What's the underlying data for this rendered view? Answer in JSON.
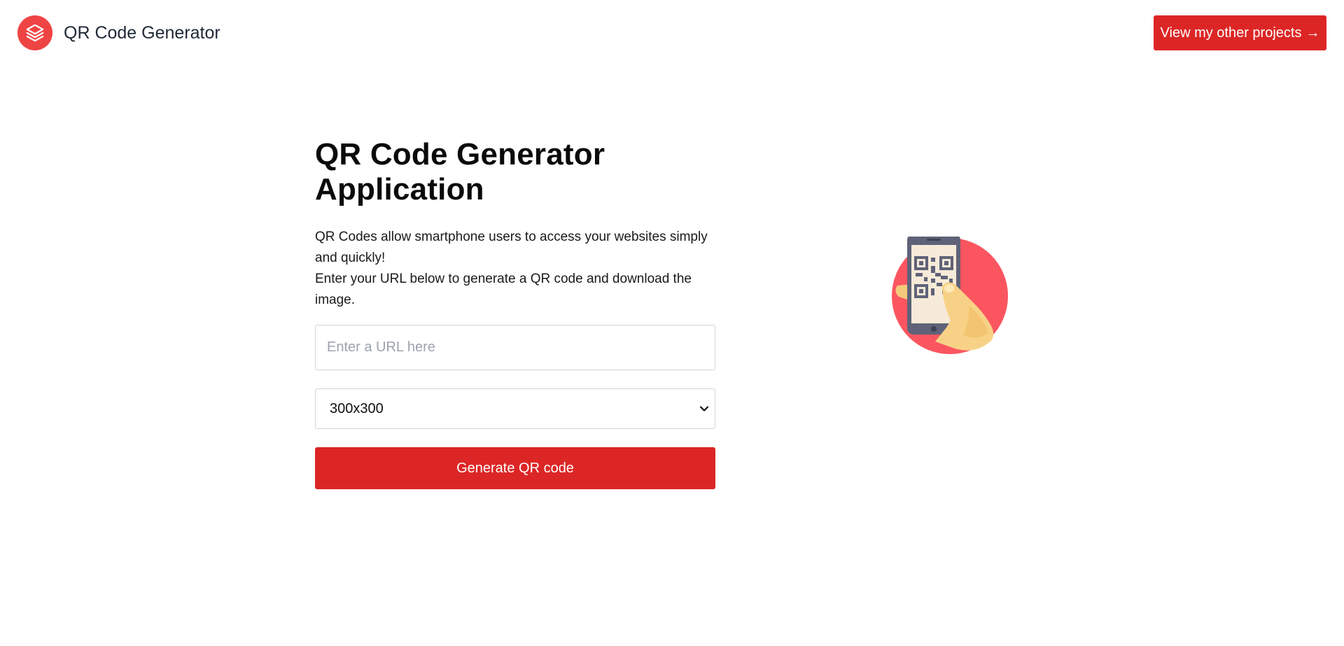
{
  "header": {
    "brand_title": "QR Code Generator",
    "cta_label": "View my other projects",
    "cta_arrow": "→"
  },
  "main": {
    "title_line1": "QR Code Generator",
    "title_line2": "Application",
    "intro_line1": "QR Codes allow smartphone users to access your websites simply and quickly!",
    "intro_line2": "Enter your URL below to generate a QR code and download the image.",
    "url_input": {
      "value": "",
      "placeholder": "Enter a URL here"
    },
    "size_select": {
      "selected": "300x300"
    },
    "generate_label": "Generate QR code"
  },
  "colors": {
    "accent": "#dc2626",
    "logo_bg": "#ef4444",
    "illustration_circle": "#fb5560"
  },
  "icons": {
    "brand": "layers-icon",
    "illustration": "phone-scanning-qr-icon",
    "select": "chevron-down-icon"
  }
}
